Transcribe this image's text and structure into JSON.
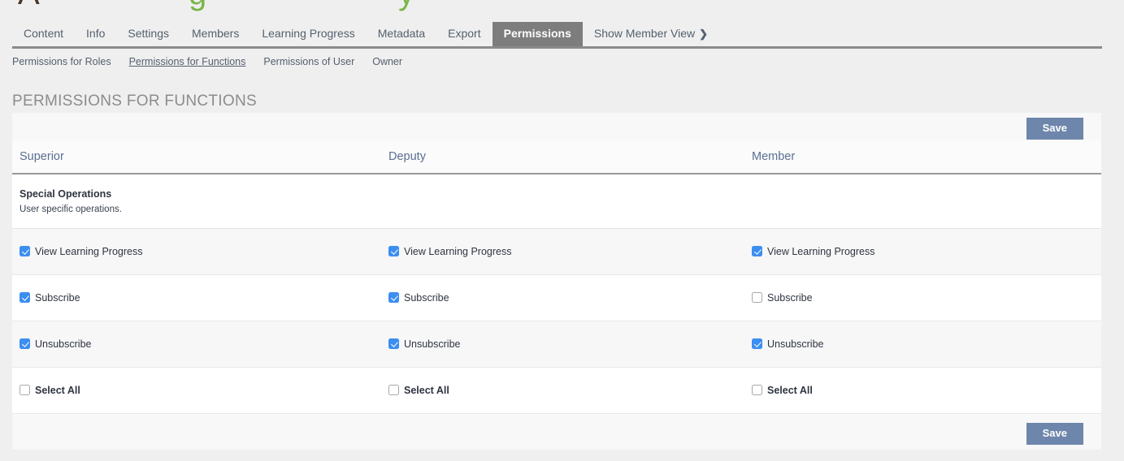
{
  "logo": {
    "glyph_a": "A",
    "glyph_g": "g",
    "glyph_y": "y",
    "color_brown": "#4a3328",
    "color_green": "#7ab648"
  },
  "tabs": [
    {
      "label": "Content",
      "active": false
    },
    {
      "label": "Info",
      "active": false
    },
    {
      "label": "Settings",
      "active": false
    },
    {
      "label": "Members",
      "active": false
    },
    {
      "label": "Learning Progress",
      "active": false
    },
    {
      "label": "Metadata",
      "active": false
    },
    {
      "label": "Export",
      "active": false
    },
    {
      "label": "Permissions",
      "active": true
    },
    {
      "label": "Show Member View",
      "active": false,
      "chevron": "❯"
    }
  ],
  "subnav": [
    {
      "label": "Permissions for Roles",
      "active": false
    },
    {
      "label": "Permissions for Functions",
      "active": true
    },
    {
      "label": "Permissions of User",
      "active": false
    },
    {
      "label": "Owner",
      "active": false
    }
  ],
  "page_title": "PERMISSIONS FOR FUNCTIONS",
  "toolbar": {
    "save_label": "Save",
    "save_label_bottom": "Save",
    "save_color": "#6e86ab"
  },
  "table": {
    "columns": [
      "Superior",
      "Deputy",
      "Member"
    ],
    "section": {
      "title": "Special Operations",
      "subtitle": "User specific operations."
    },
    "rows": [
      {
        "name": "view-learning-progress",
        "superior": {
          "label": "View Learning Progress",
          "checked": true
        },
        "deputy": {
          "label": "View Learning Progress",
          "checked": true
        },
        "member": {
          "label": "View Learning Progress",
          "checked": true
        }
      },
      {
        "name": "subscribe",
        "superior": {
          "label": "Subscribe",
          "checked": true
        },
        "deputy": {
          "label": "Subscribe",
          "checked": true
        },
        "member": {
          "label": "Subscribe",
          "checked": false
        }
      },
      {
        "name": "unsubscribe",
        "superior": {
          "label": "Unsubscribe",
          "checked": true
        },
        "deputy": {
          "label": "Unsubscribe",
          "checked": true
        },
        "member": {
          "label": "Unsubscribe",
          "checked": true
        }
      },
      {
        "name": "select-all",
        "bold": true,
        "superior": {
          "label": "Select All",
          "checked": false
        },
        "deputy": {
          "label": "Select All",
          "checked": false
        },
        "member": {
          "label": "Select All",
          "checked": false
        }
      }
    ]
  },
  "colors": {
    "checkbox_checked": "#3c8ef0",
    "checkbox_border": "#a6a9ad",
    "active_tab_bg": "#7d7d7d",
    "page_bg": "#efefef"
  }
}
